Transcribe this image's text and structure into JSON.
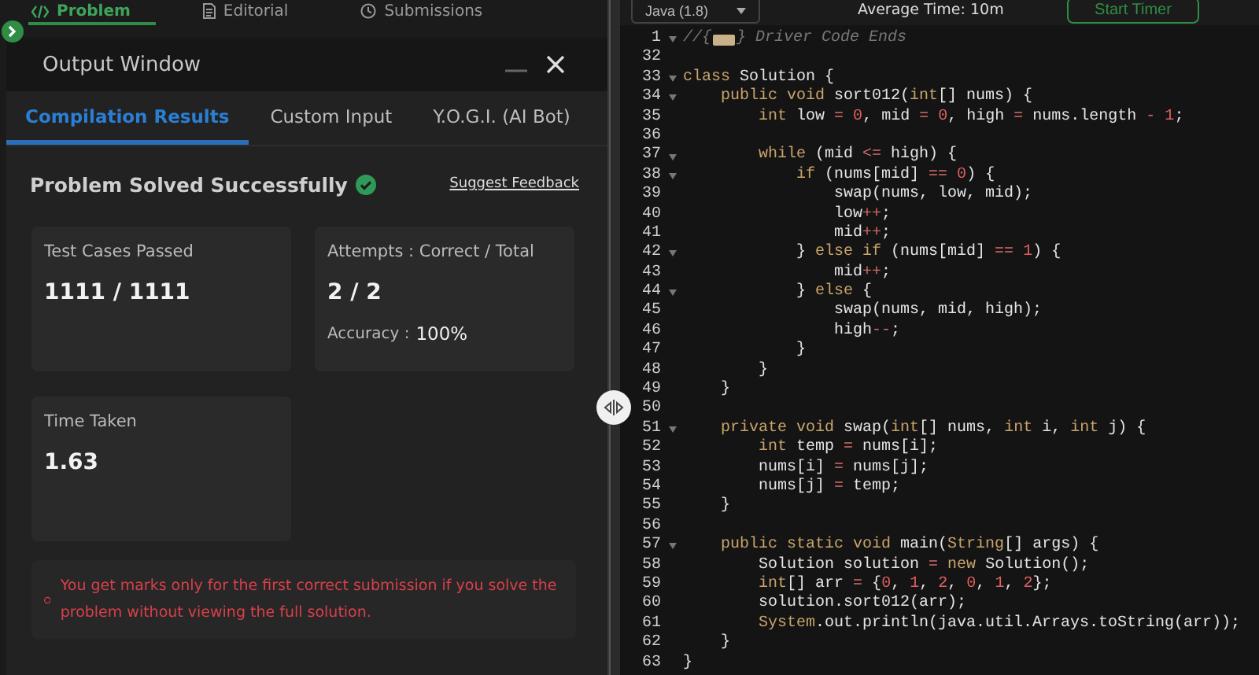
{
  "problem_tabs": [
    {
      "label": "Problem",
      "selected": true
    },
    {
      "label": "Editorial",
      "selected": false
    },
    {
      "label": "Submissions",
      "selected": false
    }
  ],
  "output_window": {
    "title": "Output Window",
    "tabs": [
      {
        "label": "Compilation Results",
        "selected": true
      },
      {
        "label": "Custom Input",
        "selected": false
      },
      {
        "label": "Y.O.G.I. (AI Bot)",
        "selected": false
      }
    ],
    "status": "Problem Solved Successfully",
    "feedback_link": "Suggest Feedback",
    "cards": [
      {
        "label": "Test Cases Passed",
        "value": "1111 / 1111"
      },
      {
        "label": "Attempts : Correct / Total",
        "value": "2 / 2",
        "sub_label": "Accuracy :",
        "sub_value": "100%"
      },
      {
        "label": "Time Taken",
        "value": "1.63"
      }
    ],
    "notice": "You get marks only for the first correct submission if you solve the problem without viewing the full solution."
  },
  "editor_bar": {
    "language": "Java (1.8)",
    "average_time": "Average Time: 10m",
    "timer_button": "Start Timer"
  },
  "code_lines": [
    {
      "number": "1",
      "foldable": true,
      "collapsed": true,
      "tokens": [
        {
          "kind": "comment",
          "text": "//{"
        },
        {
          "kind": "comment",
          "text": "} Driver Code Ends"
        }
      ]
    },
    {
      "number": "32",
      "foldable": false
    },
    {
      "number": "33",
      "foldable": true,
      "tokens": [
        {
          "kind": "keyword",
          "text": "class"
        },
        {
          "kind": "plain",
          "text": " Solution {"
        }
      ]
    },
    {
      "number": "34",
      "foldable": true,
      "tokens": [
        {
          "kind": "keyword",
          "text": "    public void"
        },
        {
          "kind": "plain",
          "text": " sort012("
        },
        {
          "kind": "keyword",
          "text": "int"
        },
        {
          "kind": "plain",
          "text": "[] nums) {"
        }
      ]
    },
    {
      "number": "35",
      "foldable": false,
      "tokens": [
        {
          "kind": "keyword",
          "text": "        int"
        },
        {
          "kind": "plain",
          "text": " low "
        },
        {
          "kind": "operator",
          "text": "="
        },
        {
          "kind": "number",
          "text": " 0"
        },
        {
          "kind": "plain",
          "text": ", mid "
        },
        {
          "kind": "operator",
          "text": "="
        },
        {
          "kind": "number",
          "text": " 0"
        },
        {
          "kind": "plain",
          "text": ", high "
        },
        {
          "kind": "operator",
          "text": "="
        },
        {
          "kind": "plain",
          "text": " nums.length "
        },
        {
          "kind": "operator",
          "text": "-"
        },
        {
          "kind": "number",
          "text": " 1"
        },
        {
          "kind": "plain",
          "text": ";"
        }
      ]
    },
    {
      "number": "36",
      "foldable": false
    },
    {
      "number": "37",
      "foldable": true,
      "tokens": [
        {
          "kind": "keyword",
          "text": "        while"
        },
        {
          "kind": "plain",
          "text": " (mid "
        },
        {
          "kind": "operator",
          "text": "<="
        },
        {
          "kind": "plain",
          "text": " high) {"
        }
      ]
    },
    {
      "number": "38",
      "foldable": true,
      "tokens": [
        {
          "kind": "keyword",
          "text": "            if"
        },
        {
          "kind": "plain",
          "text": " (nums[mid] "
        },
        {
          "kind": "operator",
          "text": "=="
        },
        {
          "kind": "number",
          "text": " 0"
        },
        {
          "kind": "plain",
          "text": ") {"
        }
      ]
    },
    {
      "number": "39",
      "foldable": false,
      "tokens": [
        {
          "kind": "plain",
          "text": "                swap(nums, low, mid);"
        }
      ]
    },
    {
      "number": "40",
      "foldable": false,
      "tokens": [
        {
          "kind": "plain",
          "text": "                low"
        },
        {
          "kind": "operator",
          "text": "++"
        },
        {
          "kind": "plain",
          "text": ";"
        }
      ]
    },
    {
      "number": "41",
      "foldable": false,
      "tokens": [
        {
          "kind": "plain",
          "text": "                mid"
        },
        {
          "kind": "operator",
          "text": "++"
        },
        {
          "kind": "plain",
          "text": ";"
        }
      ]
    },
    {
      "number": "42",
      "foldable": true,
      "tokens": [
        {
          "kind": "plain",
          "text": "            } "
        },
        {
          "kind": "keyword",
          "text": "else if"
        },
        {
          "kind": "plain",
          "text": " (nums[mid] "
        },
        {
          "kind": "operator",
          "text": "=="
        },
        {
          "kind": "number",
          "text": " 1"
        },
        {
          "kind": "plain",
          "text": ") {"
        }
      ]
    },
    {
      "number": "43",
      "foldable": false,
      "tokens": [
        {
          "kind": "plain",
          "text": "                mid"
        },
        {
          "kind": "operator",
          "text": "++"
        },
        {
          "kind": "plain",
          "text": ";"
        }
      ]
    },
    {
      "number": "44",
      "foldable": true,
      "tokens": [
        {
          "kind": "plain",
          "text": "            } "
        },
        {
          "kind": "keyword",
          "text": "else"
        },
        {
          "kind": "plain",
          "text": " {"
        }
      ]
    },
    {
      "number": "45",
      "foldable": false,
      "tokens": [
        {
          "kind": "plain",
          "text": "                swap(nums, mid, high);"
        }
      ]
    },
    {
      "number": "46",
      "foldable": false,
      "tokens": [
        {
          "kind": "plain",
          "text": "                high"
        },
        {
          "kind": "operator",
          "text": "--"
        },
        {
          "kind": "plain",
          "text": ";"
        }
      ]
    },
    {
      "number": "47",
      "foldable": false,
      "tokens": [
        {
          "kind": "plain",
          "text": "            }"
        }
      ]
    },
    {
      "number": "48",
      "foldable": false,
      "tokens": [
        {
          "kind": "plain",
          "text": "        }"
        }
      ]
    },
    {
      "number": "49",
      "foldable": false,
      "tokens": [
        {
          "kind": "plain",
          "text": "    }"
        }
      ]
    },
    {
      "number": "50",
      "foldable": false
    },
    {
      "number": "51",
      "foldable": true,
      "tokens": [
        {
          "kind": "keyword",
          "text": "    private void"
        },
        {
          "kind": "plain",
          "text": " swap("
        },
        {
          "kind": "keyword",
          "text": "int"
        },
        {
          "kind": "plain",
          "text": "[] nums, "
        },
        {
          "kind": "keyword",
          "text": "int"
        },
        {
          "kind": "plain",
          "text": " i, "
        },
        {
          "kind": "keyword",
          "text": "int"
        },
        {
          "kind": "plain",
          "text": " j) {"
        }
      ]
    },
    {
      "number": "52",
      "foldable": false,
      "tokens": [
        {
          "kind": "keyword",
          "text": "        int"
        },
        {
          "kind": "plain",
          "text": " temp "
        },
        {
          "kind": "operator",
          "text": "="
        },
        {
          "kind": "plain",
          "text": " nums[i];"
        }
      ]
    },
    {
      "number": "53",
      "foldable": false,
      "tokens": [
        {
          "kind": "plain",
          "text": "        nums[i] "
        },
        {
          "kind": "operator",
          "text": "="
        },
        {
          "kind": "plain",
          "text": " nums[j];"
        }
      ]
    },
    {
      "number": "54",
      "foldable": false,
      "tokens": [
        {
          "kind": "plain",
          "text": "        nums[j] "
        },
        {
          "kind": "operator",
          "text": "="
        },
        {
          "kind": "plain",
          "text": " temp;"
        }
      ]
    },
    {
      "number": "55",
      "foldable": false,
      "tokens": [
        {
          "kind": "plain",
          "text": "    }"
        }
      ]
    },
    {
      "number": "56",
      "foldable": false
    },
    {
      "number": "57",
      "foldable": true,
      "tokens": [
        {
          "kind": "keyword",
          "text": "    public static void"
        },
        {
          "kind": "plain",
          "text": " main("
        },
        {
          "kind": "keyword",
          "text": "String"
        },
        {
          "kind": "plain",
          "text": "[] args) {"
        }
      ]
    },
    {
      "number": "58",
      "foldable": false,
      "tokens": [
        {
          "kind": "plain",
          "text": "        Solution solution "
        },
        {
          "kind": "operator",
          "text": "="
        },
        {
          "kind": "keyword",
          "text": " new"
        },
        {
          "kind": "plain",
          "text": " Solution();"
        }
      ]
    },
    {
      "number": "59",
      "foldable": false,
      "tokens": [
        {
          "kind": "keyword",
          "text": "        int"
        },
        {
          "kind": "plain",
          "text": "[] arr "
        },
        {
          "kind": "operator",
          "text": "="
        },
        {
          "kind": "plain",
          "text": " {"
        },
        {
          "kind": "number",
          "text": "0"
        },
        {
          "kind": "plain",
          "text": ", "
        },
        {
          "kind": "number",
          "text": "1"
        },
        {
          "kind": "plain",
          "text": ", "
        },
        {
          "kind": "number",
          "text": "2"
        },
        {
          "kind": "plain",
          "text": ", "
        },
        {
          "kind": "number",
          "text": "0"
        },
        {
          "kind": "plain",
          "text": ", "
        },
        {
          "kind": "number",
          "text": "1"
        },
        {
          "kind": "plain",
          "text": ", "
        },
        {
          "kind": "number",
          "text": "2"
        },
        {
          "kind": "plain",
          "text": "};"
        }
      ]
    },
    {
      "number": "60",
      "foldable": false,
      "tokens": [
        {
          "kind": "plain",
          "text": "        solution.sort012(arr);"
        }
      ]
    },
    {
      "number": "61",
      "foldable": false,
      "tokens": [
        {
          "kind": "keyword",
          "text": "        System"
        },
        {
          "kind": "plain",
          "text": ".out.println(java.util.Arrays.toString(arr));"
        }
      ]
    },
    {
      "number": "62",
      "foldable": false,
      "tokens": [
        {
          "kind": "plain",
          "text": "    }"
        }
      ]
    },
    {
      "number": "63",
      "foldable": false,
      "tokens": [
        {
          "kind": "plain",
          "text": "}"
        }
      ]
    }
  ]
}
